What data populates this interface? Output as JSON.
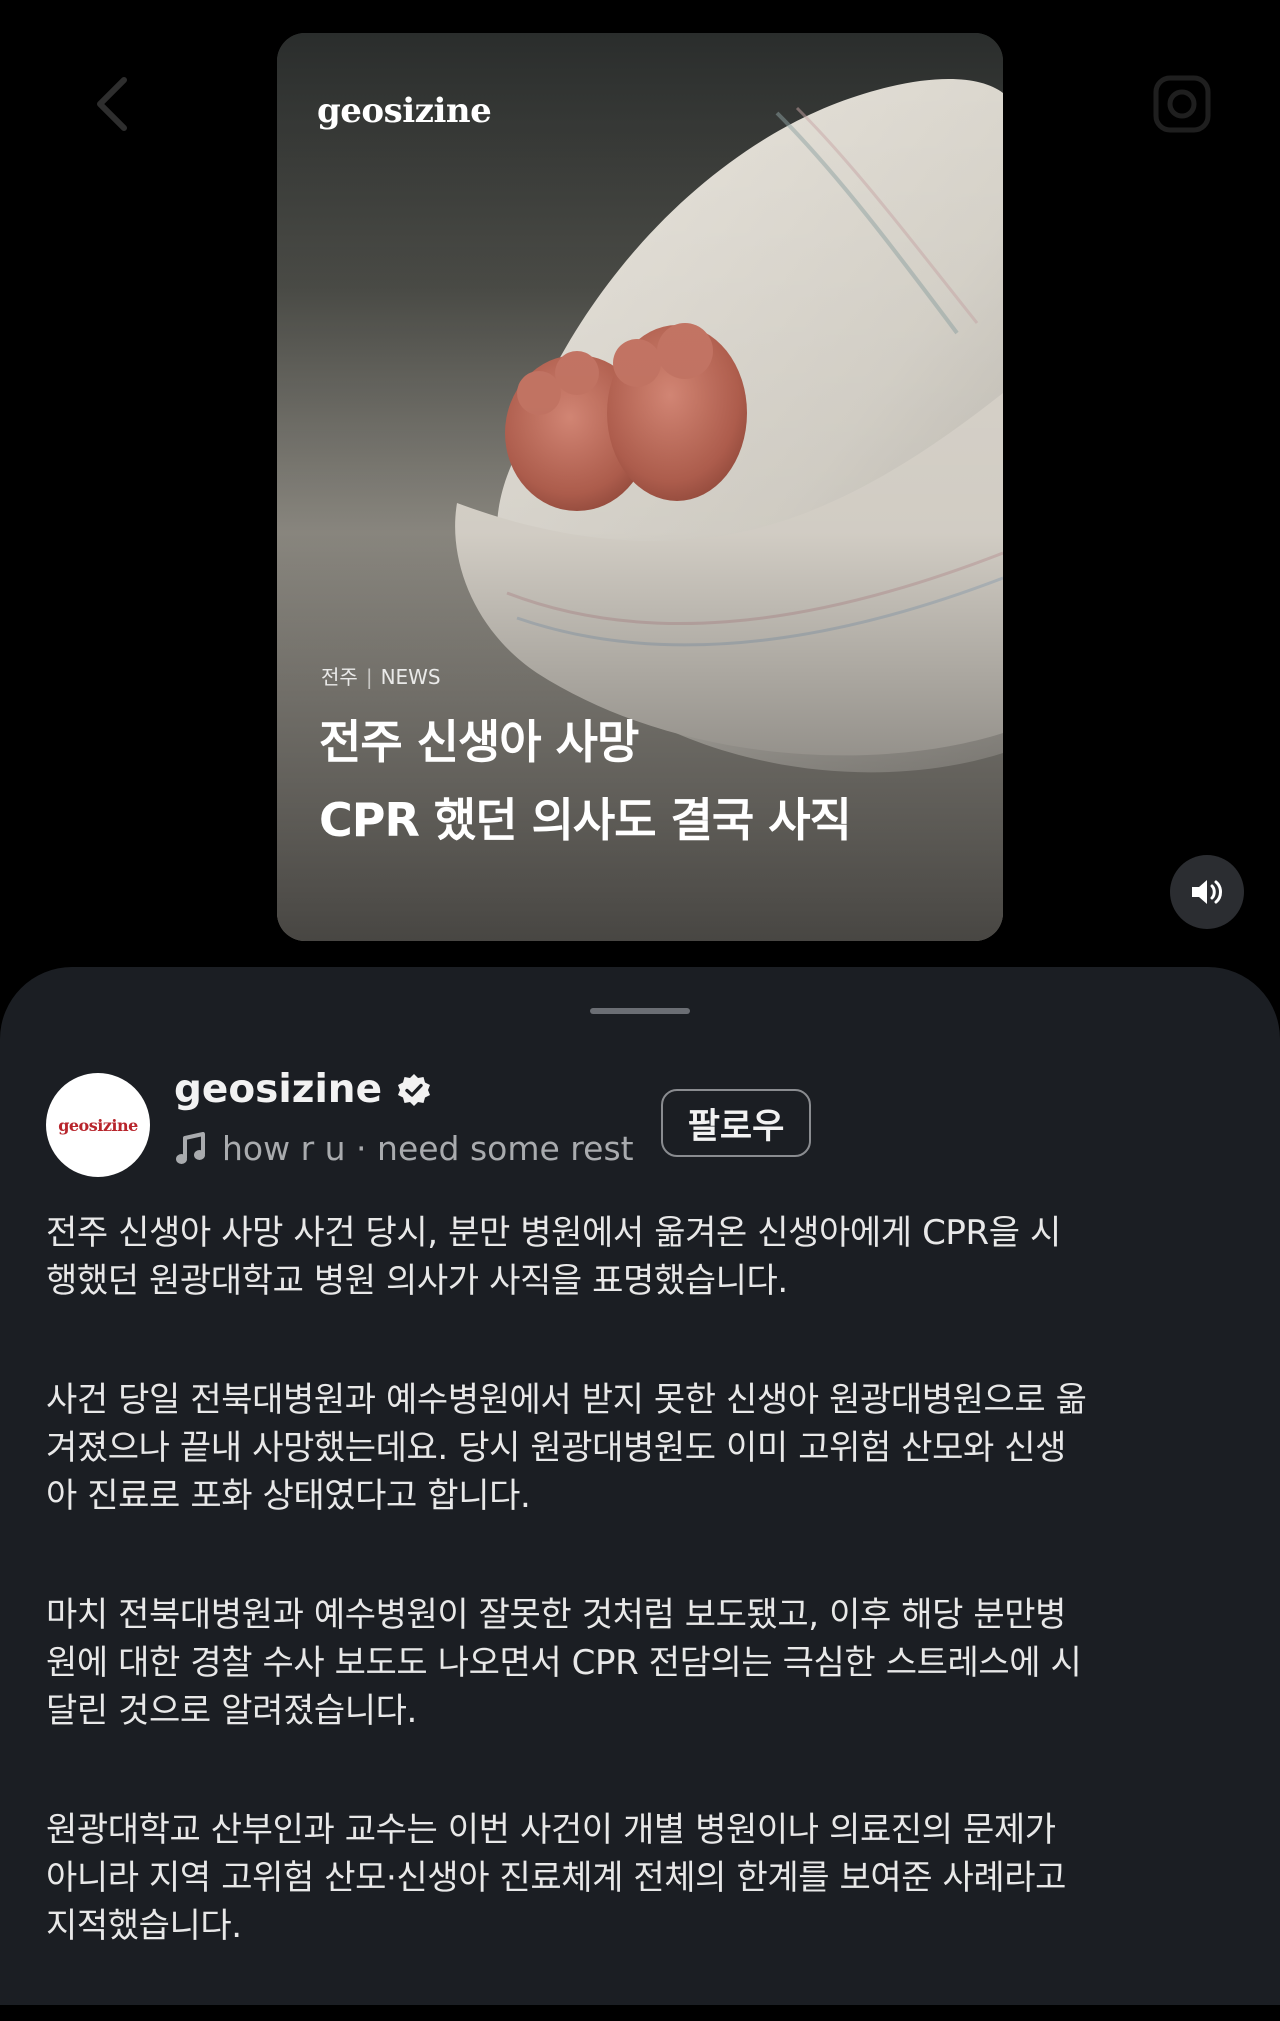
{
  "card": {
    "brand": "geosizine",
    "category_region": "전주",
    "category_separator": "|",
    "category_tag": "NEWS",
    "headline_line1": "전주 신생아 사망",
    "headline_line2": "CPR 했던 의사도 결국 사직"
  },
  "profile": {
    "avatar_text": "geosizine",
    "name": "geosizine",
    "music_text": "how r u · need some rest",
    "follow_label": "팔로우"
  },
  "caption": {
    "p1_l1": "전주 신생아 사망 사건 당시, 분만 병원에서 옮겨온 신생아에게 CPR을 시",
    "p1_l2": "행했던 원광대학교 병원 의사가 사직을 표명했습니다.",
    "p2_l1": "사건 당일 전북대병원과 예수병원에서 받지 못한 신생아 원광대병원으로 옮",
    "p2_l2": "겨졌으나 끝내 사망했는데요. 당시 원광대병원도 이미 고위험 산모와 신생",
    "p2_l3": "아 진료로 포화 상태였다고 합니다.",
    "p3_l1": "마치 전북대병원과 예수병원이 잘못한 것처럼 보도됐고, 이후 해당 분만병",
    "p3_l2": "원에 대한 경찰 수사 보도도 나오면서 CPR 전담의는 극심한 스트레스에 시",
    "p3_l3": "달린 것으로 알려졌습니다.",
    "p4_l1": "원광대학교 산부인과 교수는 이번 사건이 개별 병원이나 의료진의 문제가",
    "p4_l2": "아니라 지역 고위험 산모·신생아 진료체계 전체의 한계를 보여준 사례라고",
    "p4_l3": "지적했습니다."
  },
  "icons": {
    "back": "chevron-left-icon",
    "camera": "camera-icon",
    "sound": "speaker-icon",
    "verified": "verified-badge-icon",
    "music": "music-note-icon"
  },
  "colors": {
    "background": "#000000",
    "sheet": "#1b1e23",
    "text_primary": "#f2f2f2",
    "text_secondary": "#a9abae",
    "brand_red": "#b8252c"
  }
}
